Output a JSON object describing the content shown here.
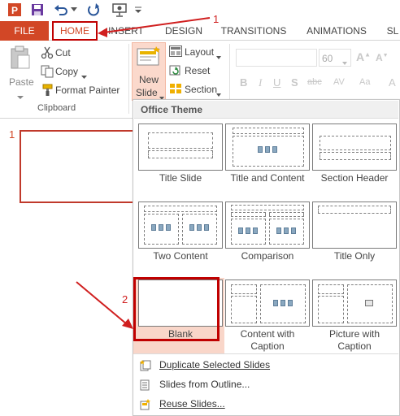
{
  "colors": {
    "accent": "#d24726",
    "annotation_red": "#c00000",
    "gallery_bg": "#ffffff",
    "selected_bg": "#f9d6c9"
  },
  "quick_access": {
    "icons": [
      "powerpoint-icon",
      "save-icon",
      "undo-icon",
      "redo-icon",
      "start-presentation-icon",
      "customize-qat-icon"
    ]
  },
  "tabs": {
    "file": "FILE",
    "home": "HOME",
    "insert": "INSERT",
    "design": "DESIGN",
    "transitions": "TRANSITIONS",
    "animations": "ANIMATIONS",
    "overflow": "SL"
  },
  "annotations": {
    "step1": "1",
    "step2": "2",
    "thumb_number": "1"
  },
  "clipboard": {
    "paste": "Paste",
    "cut": "Cut",
    "copy": "Copy",
    "format_painter": "Format Painter",
    "group_name": "Clipboard"
  },
  "slides_group": {
    "new_slide_line1": "New",
    "new_slide_line2": "Slide",
    "layout": "Layout",
    "reset": "Reset",
    "section": "Section"
  },
  "font": {
    "size": "60",
    "name_value": ""
  },
  "gallery": {
    "header": "Office Theme",
    "layouts": [
      {
        "name": "Title Slide"
      },
      {
        "name": "Title and Content"
      },
      {
        "name": "Section Header"
      },
      {
        "name": "Two Content"
      },
      {
        "name": "Comparison"
      },
      {
        "name": "Title Only"
      },
      {
        "name": "Blank",
        "selected": true
      },
      {
        "name_line1": "Content with",
        "name_line2": "Caption"
      },
      {
        "name_line1": "Picture with",
        "name_line2": "Caption"
      }
    ],
    "menu": [
      {
        "label": "Duplicate Selected Slides",
        "icon": "duplicate-slides-icon"
      },
      {
        "label": "Slides from Outline...",
        "icon": "slides-from-outline-icon"
      },
      {
        "label": "Reuse Slides...",
        "icon": "reuse-slides-icon"
      }
    ]
  }
}
